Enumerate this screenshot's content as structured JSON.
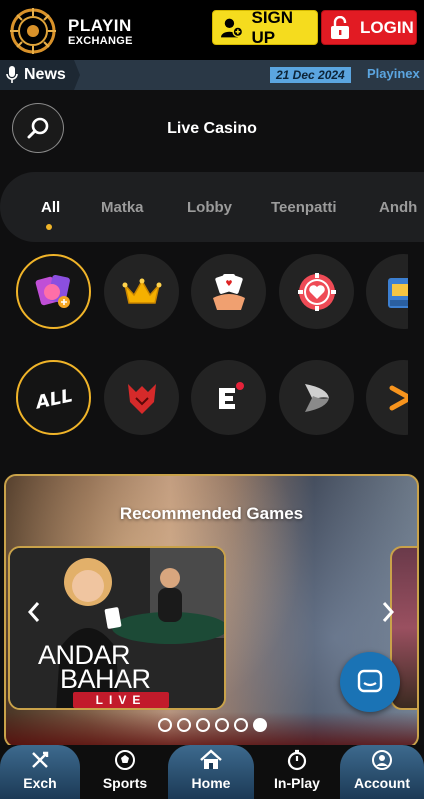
{
  "header": {
    "logo_line1": "PLAYIN",
    "logo_line2": "EXCHANGE",
    "signup_label": "SIGN UP",
    "login_label": "LOGIN",
    "colors": {
      "signup": "#f5dc1e",
      "login": "#e21b23"
    }
  },
  "news": {
    "label": "News",
    "date": "21 Dec 2024",
    "text": "Playinex"
  },
  "search": {
    "icon": "search-icon"
  },
  "page_title": "Live Casino",
  "tabs": [
    {
      "label": "All",
      "active": true
    },
    {
      "label": "Matka",
      "active": false
    },
    {
      "label": "Lobby",
      "active": false
    },
    {
      "label": "Teenpatti",
      "active": false
    },
    {
      "label": "Andh",
      "active": false
    }
  ],
  "category_icons": [
    "casino-cards-icon",
    "crown-icon",
    "hand-cards-icon",
    "poker-chip-heart-icon",
    "slot-machine-icon"
  ],
  "provider_icons": [
    "all-providers-icon",
    "red-tiger-icon",
    "ezugi-icon",
    "provider-swirl-icon",
    "provider-arrow-icon"
  ],
  "banner": {
    "title": "Recommended Games",
    "game_line1": "ANDAR",
    "game_line2": "BAHAR",
    "game_tag": "LIVE",
    "pager_total": 6,
    "pager_active": 6
  },
  "bottom_nav": [
    {
      "label": "Exch",
      "icon": "exchange-icon"
    },
    {
      "label": "Sports",
      "icon": "sports-icon"
    },
    {
      "label": "Home",
      "icon": "home-icon"
    },
    {
      "label": "In-Play",
      "icon": "inplay-icon"
    },
    {
      "label": "Account",
      "icon": "account-icon"
    }
  ]
}
